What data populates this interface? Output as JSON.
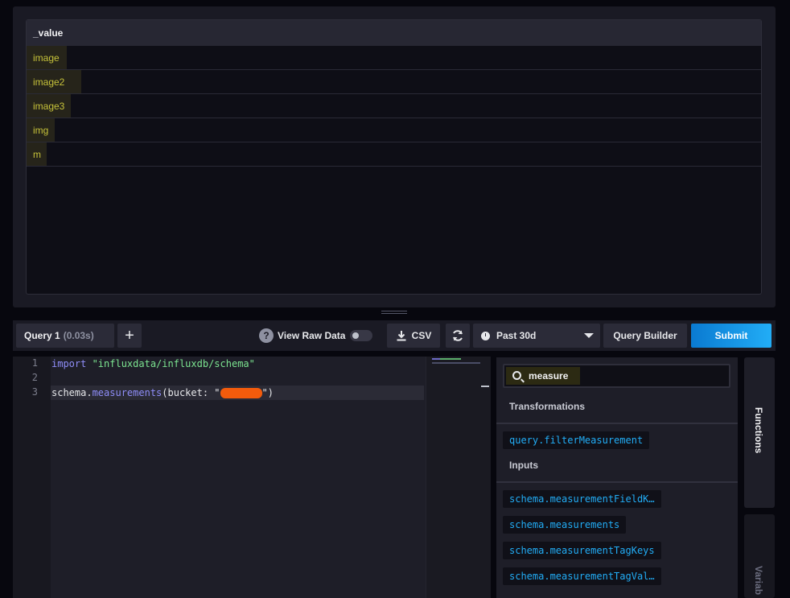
{
  "results": {
    "column_header": "_value",
    "rows": [
      "image",
      "image2",
      "image3",
      "img",
      "m"
    ]
  },
  "toolbar": {
    "query_tab_label": "Query 1",
    "query_tab_time": "(0.03s)",
    "add_label": "+",
    "help_glyph": "?",
    "raw_data_label": "View Raw Data",
    "raw_data_enabled": false,
    "csv_label": "CSV",
    "time_range": "Past 30d",
    "query_builder_label": "Query Builder",
    "submit_label": "Submit"
  },
  "editor": {
    "line_numbers": [
      "1",
      "2",
      "3"
    ],
    "line1": {
      "keyword": "import",
      "string": " \"influxdata/influxdb/schema\""
    },
    "line3": {
      "prefix": "schema.",
      "func": "measurements",
      "open": "(bucket: \"",
      "close": "\")"
    }
  },
  "functions_panel": {
    "search_value": "measure",
    "categories": [
      {
        "title": "Transformations",
        "items": [
          "query.filterMeasurement"
        ]
      },
      {
        "title": "Inputs",
        "items": [
          "schema.measurementFieldK…",
          "schema.measurements",
          "schema.measurementTagKeys",
          "schema.measurementTagVal…"
        ]
      }
    ]
  },
  "side_tabs": {
    "functions": "Functions",
    "variables": "Variab"
  },
  "colors": {
    "accent": "#22adf6",
    "submit_gradient": [
      "#0a7ad1",
      "#22adf6"
    ],
    "highlight_text": "#c6c23a",
    "keyword": "#8f8ef9",
    "string": "#7ce490",
    "redaction": "#f35b0c"
  },
  "icons": {
    "help": "help-icon",
    "download": "download-icon",
    "refresh": "refresh-icon",
    "clock": "clock-icon",
    "chevron": "chevron-down-icon",
    "search": "search-icon"
  }
}
